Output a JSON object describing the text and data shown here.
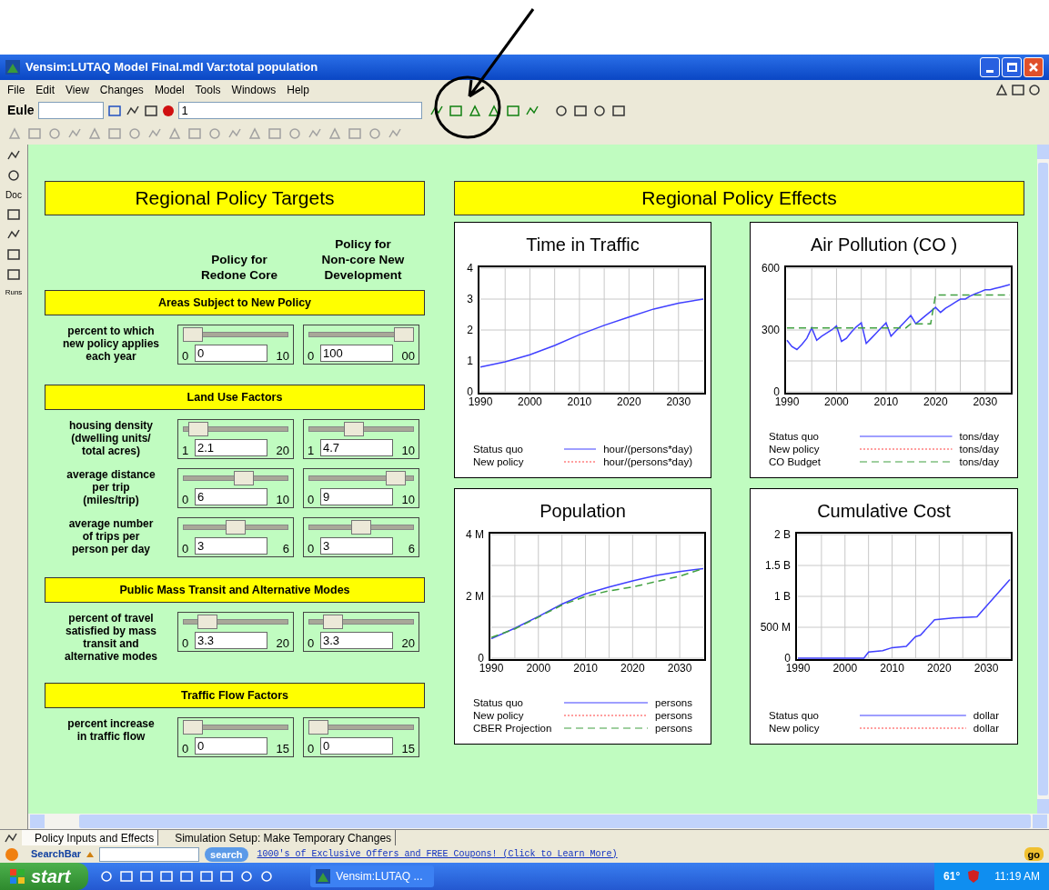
{
  "window": {
    "title": "Vensim:LUTAQ Model Final.mdl Var:total population"
  },
  "menu": [
    "File",
    "Edit",
    "View",
    "Changes",
    "Model",
    "Tools",
    "Windows",
    "Help"
  ],
  "toolbar": {
    "sim_label": "Eule",
    "run_value": "1"
  },
  "left_strip": {
    "doc_label": "Doc",
    "runs_label": "Runs"
  },
  "targets": {
    "title": "Regional Policy Targets",
    "columns": [
      "Policy for\nRedone Core",
      "Policy for\nNon-core New\nDevelopment"
    ],
    "sections": [
      {
        "title": "Areas Subject to New Policy",
        "rows": [
          {
            "label": "percent to which\nnew policy applies\neach year",
            "sliders": [
              {
                "min": "0",
                "value": "0",
                "max": "10",
                "level": 0
              },
              {
                "min": "0",
                "value": "100",
                "max": "00",
                "level": 1
              }
            ]
          }
        ]
      },
      {
        "title": "Land Use Factors",
        "rows": [
          {
            "label": "housing density\n(dwelling units/\ntotal acres)",
            "sliders": [
              {
                "min": "1",
                "value": "2.1",
                "max": "20",
                "level": 0.06
              },
              {
                "min": "1",
                "value": "4.7",
                "max": "10",
                "level": 0.41
              }
            ]
          },
          {
            "label": "average distance\nper trip\n(miles/trip)",
            "sliders": [
              {
                "min": "0",
                "value": "6",
                "max": "10",
                "level": 0.6
              },
              {
                "min": "0",
                "value": "9",
                "max": "10",
                "level": 0.9
              }
            ]
          },
          {
            "label": "average number\nof trips per\nperson per day",
            "sliders": [
              {
                "min": "0",
                "value": "3",
                "max": "6",
                "level": 0.5
              },
              {
                "min": "0",
                "value": "3",
                "max": "6",
                "level": 0.5
              }
            ]
          }
        ]
      },
      {
        "title": "Public Mass Transit and Alternative Modes",
        "rows": [
          {
            "label": "percent of travel\nsatisfied by mass\ntransit and\nalternative modes",
            "sliders": [
              {
                "min": "0",
                "value": "3.3",
                "max": "20",
                "level": 0.165
              },
              {
                "min": "0",
                "value": "3.3",
                "max": "20",
                "level": 0.165
              }
            ]
          }
        ]
      },
      {
        "title": "Traffic Flow Factors",
        "rows": [
          {
            "label": "percent increase\nin traffic flow",
            "sliders": [
              {
                "min": "0",
                "value": "0",
                "max": "15",
                "level": 0
              },
              {
                "min": "0",
                "value": "0",
                "max": "15",
                "level": 0
              }
            ]
          }
        ]
      }
    ]
  },
  "effects": {
    "title": "Regional Policy Effects",
    "charts": [
      {
        "chart_data": {
          "type": "line",
          "title": "Time in Traffic",
          "grid": true,
          "x": [
            1990,
            1995,
            2000,
            2005,
            2010,
            2015,
            2020,
            2025,
            2030,
            2035
          ],
          "xlim": [
            1990,
            2035
          ],
          "ylim": [
            0,
            4
          ],
          "xticks": [
            1990,
            2000,
            2010,
            2020,
            2030
          ],
          "yticks": [
            0,
            1,
            2,
            3,
            4
          ],
          "series": [
            {
              "name": "Status quo",
              "color": "#4040ff",
              "line_style": "solid",
              "values": [
                0.8,
                0.97,
                1.2,
                1.5,
                1.85,
                2.15,
                2.42,
                2.68,
                2.87,
                3.0
              ]
            },
            {
              "name": "New policy",
              "color": "#ff4040",
              "line_style": "dotted",
              "values": [
                null,
                null,
                null,
                null,
                null,
                null,
                null,
                null,
                null,
                null
              ]
            }
          ]
        },
        "units": [
          "hour/(persons*day)",
          "hour/(persons*day)"
        ]
      },
      {
        "chart_data": {
          "type": "line",
          "title": "Air Pollution (CO )",
          "grid": true,
          "x": [
            1990,
            1991,
            1992,
            1993,
            1994,
            1995,
            1996,
            1997,
            1998,
            1999,
            2000,
            2001,
            2002,
            2003,
            2004,
            2005,
            2006,
            2007,
            2008,
            2009,
            2010,
            2011,
            2012,
            2013,
            2014,
            2015,
            2016,
            2017,
            2018,
            2019,
            2020,
            2021,
            2022,
            2023,
            2024,
            2025,
            2026,
            2027,
            2028,
            2029,
            2030,
            2031,
            2032,
            2033,
            2034,
            2035
          ],
          "xlim": [
            1990,
            2035
          ],
          "ylim": [
            0,
            600
          ],
          "xticks": [
            1990,
            2000,
            2010,
            2020,
            2030
          ],
          "yticks": [
            0,
            300,
            600
          ],
          "series": [
            {
              "name": "Status quo",
              "color": "#4040ff",
              "line_style": "solid",
              "values": [
                250,
                220,
                205,
                230,
                260,
                310,
                250,
                270,
                285,
                300,
                320,
                245,
                260,
                290,
                315,
                335,
                235,
                260,
                285,
                310,
                335,
                270,
                295,
                320,
                345,
                370,
                330,
                350,
                370,
                390,
                410,
                385,
                405,
                420,
                435,
                450,
                450,
                465,
                475,
                485,
                495,
                495,
                502,
                508,
                514,
                520
              ]
            },
            {
              "name": "New policy",
              "color": "#ff4040",
              "line_style": "dotted",
              "values": [
                null,
                null,
                null,
                null,
                null,
                null,
                null,
                null,
                null,
                null,
                null,
                null,
                null,
                null,
                null,
                null,
                null,
                null,
                null,
                null,
                null,
                null,
                null,
                null,
                null,
                null,
                null,
                null,
                null,
                null,
                null,
                null,
                null,
                null,
                null,
                null,
                null,
                null,
                null,
                null,
                null,
                null,
                null,
                null,
                null,
                null
              ]
            },
            {
              "name": "CO Budget",
              "color": "#40a040",
              "line_style": "dashed",
              "values": [
                310,
                310,
                310,
                310,
                310,
                310,
                310,
                310,
                310,
                310,
                310,
                310,
                310,
                310,
                310,
                310,
                310,
                310,
                310,
                310,
                310,
                310,
                310,
                310,
                310,
                330,
                330,
                330,
                330,
                330,
                470,
                470,
                470,
                470,
                470,
                470,
                470,
                470,
                470,
                470,
                470,
                470,
                470,
                470,
                470,
                470
              ]
            }
          ]
        },
        "units": [
          "tons/day",
          "tons/day",
          "tons/day"
        ]
      },
      {
        "chart_data": {
          "type": "line",
          "title": "Population",
          "grid": true,
          "x": [
            1990,
            1995,
            2000,
            2005,
            2010,
            2015,
            2020,
            2025,
            2030,
            2035
          ],
          "xlim": [
            1990,
            2035
          ],
          "ylim": [
            0,
            4000000
          ],
          "xticks": [
            1990,
            2000,
            2010,
            2020,
            2030
          ],
          "yticks": [
            {
              "value": 0,
              "label": "0"
            },
            {
              "value": 2000000,
              "label": "2 M"
            },
            {
              "value": 4000000,
              "label": "4 M"
            }
          ],
          "series": [
            {
              "name": "Status quo",
              "color": "#4040ff",
              "line_style": "solid",
              "values": [
                630000,
                970000,
                1350000,
                1750000,
                2080000,
                2300000,
                2500000,
                2680000,
                2800000,
                2900000
              ]
            },
            {
              "name": "New policy",
              "color": "#ff4040",
              "line_style": "dotted",
              "values": [
                null,
                null,
                null,
                null,
                null,
                null,
                null,
                null,
                null,
                null
              ]
            },
            {
              "name": "CBER Projection",
              "color": "#40a040",
              "line_style": "dashed",
              "values": [
                670000,
                950000,
                1330000,
                1720000,
                2000000,
                2180000,
                2300000,
                2480000,
                2650000,
                2900000
              ]
            }
          ]
        },
        "units": [
          "persons",
          "persons",
          "persons"
        ]
      },
      {
        "chart_data": {
          "type": "line",
          "title": "Cumulative Cost",
          "grid": true,
          "x": [
            1990,
            2004,
            2005,
            2008,
            2010,
            2013,
            2015,
            2016,
            2019,
            2023,
            2028,
            2035
          ],
          "xlim": [
            1990,
            2035
          ],
          "ylim": [
            0,
            2000000000
          ],
          "xticks": [
            1990,
            2000,
            2010,
            2020,
            2030
          ],
          "yticks": [
            {
              "value": 0,
              "label": "0"
            },
            {
              "value": 500000000,
              "label": "500 M"
            },
            {
              "value": 1000000000,
              "label": "1 B"
            },
            {
              "value": 1500000000,
              "label": "1.5 B"
            },
            {
              "value": 2000000000,
              "label": "2 B"
            }
          ],
          "series": [
            {
              "name": "Status quo",
              "color": "#4040ff",
              "line_style": "solid",
              "values": [
                0,
                0,
                100000000,
                120000000,
                170000000,
                190000000,
                350000000,
                370000000,
                620000000,
                650000000,
                670000000,
                1270000000
              ]
            },
            {
              "name": "New policy",
              "color": "#ff4040",
              "line_style": "dotted",
              "values": [
                null,
                null,
                null,
                null,
                null,
                null,
                null,
                null,
                null,
                null,
                null,
                null
              ]
            }
          ]
        },
        "units": [
          "dollar",
          "dollar"
        ]
      }
    ]
  },
  "tabs": [
    {
      "label": "Policy Inputs and Effects",
      "selected": true
    },
    {
      "label": "Simulation Setup: Make Temporary Changes",
      "selected": false
    }
  ],
  "search_bar": {
    "label": "SearchBar",
    "button": "search",
    "link": "1000's of Exclusive Offers and FREE Coupons! (Click to Learn More)",
    "go": "go"
  },
  "taskbar": {
    "start": "start",
    "task": "Vensim:LUTAQ ...",
    "temperature": "61°",
    "clock": "11:19 AM"
  }
}
